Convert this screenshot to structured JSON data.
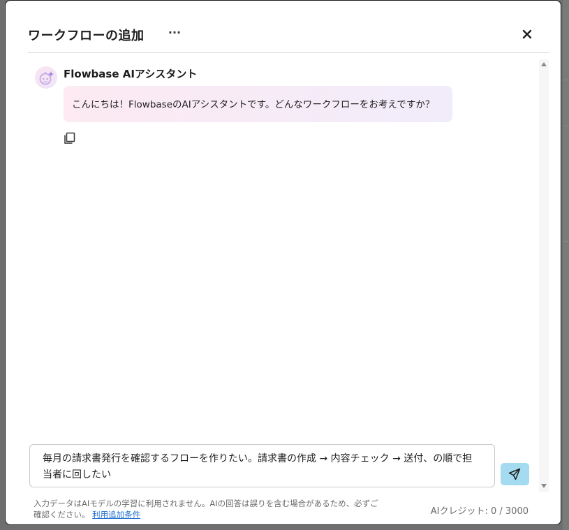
{
  "modal": {
    "title": "ワークフローの追加",
    "more_label": "···",
    "close_icon": "close-icon"
  },
  "message": {
    "sender": "Flowbase AIアシスタント",
    "text": "こんにちは！FlowbaseのAIアシスタントです。どんなワークフローをお考えですか？",
    "avatar_icon": "robot-sparkle-icon",
    "copy_icon": "copy-icon"
  },
  "input": {
    "value_line1": "毎月の請求書発行を確認するフローを作りたい。請求書の作成 → 内容チェック → 送付、の順で担",
    "value_line2": "当者に回したい",
    "send_icon": "send-icon"
  },
  "footer": {
    "disclaimer_line1": "入力データはAIモデルの学習に利用されません。AIの回答は誤りを含む場合があるため、必ずご",
    "disclaimer_line2": "確認ください。",
    "terms_link": "利用追加条件",
    "credits_label": "AIクレジット: 0 / 3000"
  },
  "colors": {
    "send_button": "#a4dbf0",
    "link": "#1f6fd0",
    "bubble_start": "#fdeaf2",
    "bubble_end": "#f1ecfb"
  }
}
